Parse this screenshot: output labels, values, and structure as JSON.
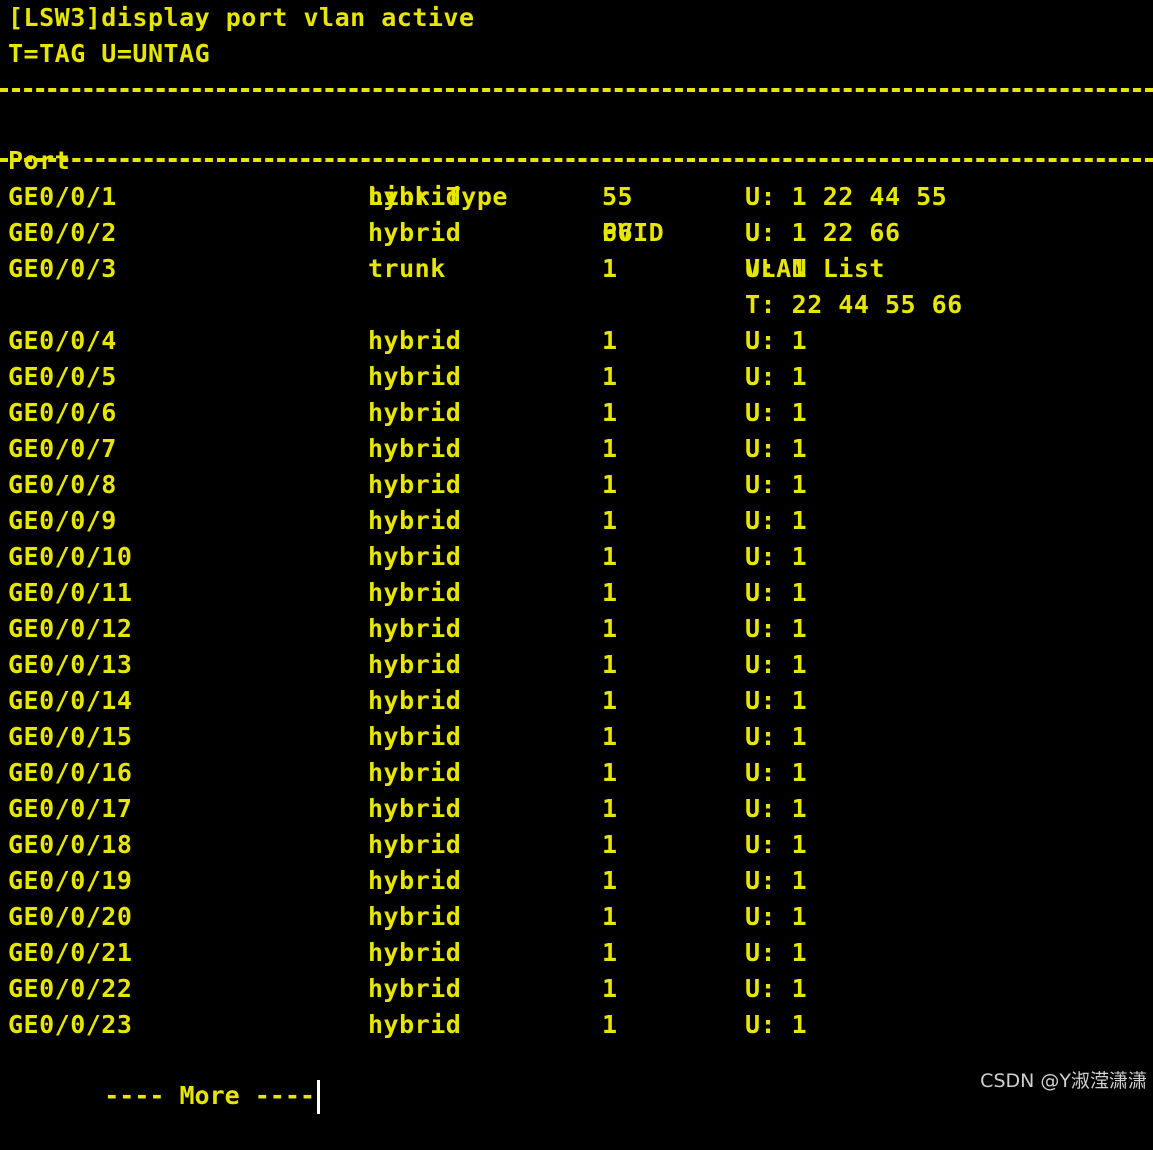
{
  "command": "[LSW3]display port vlan active",
  "legend": "T=TAG U=UNTAG",
  "headers": {
    "port": "Port",
    "link_type": "Link Type",
    "pvid": "PVID",
    "vlan_list": "VLAN List"
  },
  "rows": [
    {
      "port": "GE0/0/1",
      "type": "hybrid",
      "pvid": "55",
      "vlan": "U: 1 22 44 55"
    },
    {
      "port": "GE0/0/2",
      "type": "hybrid",
      "pvid": "66",
      "vlan": "U: 1 22 66"
    },
    {
      "port": "GE0/0/3",
      "type": "trunk",
      "pvid": "1",
      "vlan": "U: 1"
    },
    {
      "port": "",
      "type": "",
      "pvid": "",
      "vlan": "T: 22 44 55 66"
    },
    {
      "port": "GE0/0/4",
      "type": "hybrid",
      "pvid": "1",
      "vlan": "U: 1"
    },
    {
      "port": "GE0/0/5",
      "type": "hybrid",
      "pvid": "1",
      "vlan": "U: 1"
    },
    {
      "port": "GE0/0/6",
      "type": "hybrid",
      "pvid": "1",
      "vlan": "U: 1"
    },
    {
      "port": "GE0/0/7",
      "type": "hybrid",
      "pvid": "1",
      "vlan": "U: 1"
    },
    {
      "port": "GE0/0/8",
      "type": "hybrid",
      "pvid": "1",
      "vlan": "U: 1"
    },
    {
      "port": "GE0/0/9",
      "type": "hybrid",
      "pvid": "1",
      "vlan": "U: 1"
    },
    {
      "port": "GE0/0/10",
      "type": "hybrid",
      "pvid": "1",
      "vlan": "U: 1"
    },
    {
      "port": "GE0/0/11",
      "type": "hybrid",
      "pvid": "1",
      "vlan": "U: 1"
    },
    {
      "port": "GE0/0/12",
      "type": "hybrid",
      "pvid": "1",
      "vlan": "U: 1"
    },
    {
      "port": "GE0/0/13",
      "type": "hybrid",
      "pvid": "1",
      "vlan": "U: 1"
    },
    {
      "port": "GE0/0/14",
      "type": "hybrid",
      "pvid": "1",
      "vlan": "U: 1"
    },
    {
      "port": "GE0/0/15",
      "type": "hybrid",
      "pvid": "1",
      "vlan": "U: 1"
    },
    {
      "port": "GE0/0/16",
      "type": "hybrid",
      "pvid": "1",
      "vlan": "U: 1"
    },
    {
      "port": "GE0/0/17",
      "type": "hybrid",
      "pvid": "1",
      "vlan": "U: 1"
    },
    {
      "port": "GE0/0/18",
      "type": "hybrid",
      "pvid": "1",
      "vlan": "U: 1"
    },
    {
      "port": "GE0/0/19",
      "type": "hybrid",
      "pvid": "1",
      "vlan": "U: 1"
    },
    {
      "port": "GE0/0/20",
      "type": "hybrid",
      "pvid": "1",
      "vlan": "U: 1"
    },
    {
      "port": "GE0/0/21",
      "type": "hybrid",
      "pvid": "1",
      "vlan": "U: 1"
    },
    {
      "port": "GE0/0/22",
      "type": "hybrid",
      "pvid": "1",
      "vlan": "U: 1"
    },
    {
      "port": "GE0/0/23",
      "type": "hybrid",
      "pvid": "1",
      "vlan": "U: 1"
    }
  ],
  "more_prompt": "---- More ----",
  "watermark": "CSDN @Y淑滢潇潇",
  "colors": {
    "background": "#000000",
    "text": "#e6e600",
    "cursor": "#ffffff",
    "watermark": "#cfcfcf"
  }
}
